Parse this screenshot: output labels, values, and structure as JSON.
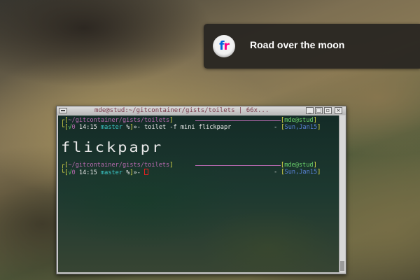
{
  "notification": {
    "icon": "flickr-icon",
    "icon_letters": {
      "f": "f",
      "r": "r"
    },
    "text": "Road over the moon"
  },
  "terminal": {
    "title": "mde@stud:~/gitcontainer/gists/toilets | 66x...",
    "prompt1": {
      "path": "~/gitcontainer/gists/toilets",
      "userhost": "mde@stud",
      "status": "0",
      "time": "14:15",
      "branch": "master",
      "mark": "%",
      "command": "toilet -f mini flickpapr",
      "date": "Sun,Jan15"
    },
    "banner": "flickpapr",
    "prompt2": {
      "path": "~/gitcontainer/gists/toilets",
      "userhost": "mde@stud",
      "status": "0",
      "time": "14:15",
      "branch": "master",
      "mark": "%",
      "date": "Sun,Jan15"
    }
  },
  "colors": {
    "yellow": "#e6e24a",
    "purple": "#b86ab0",
    "green": "#6ad06a",
    "cyan": "#3cc8c8",
    "blue": "#5a82d8",
    "red": "#e02020"
  }
}
